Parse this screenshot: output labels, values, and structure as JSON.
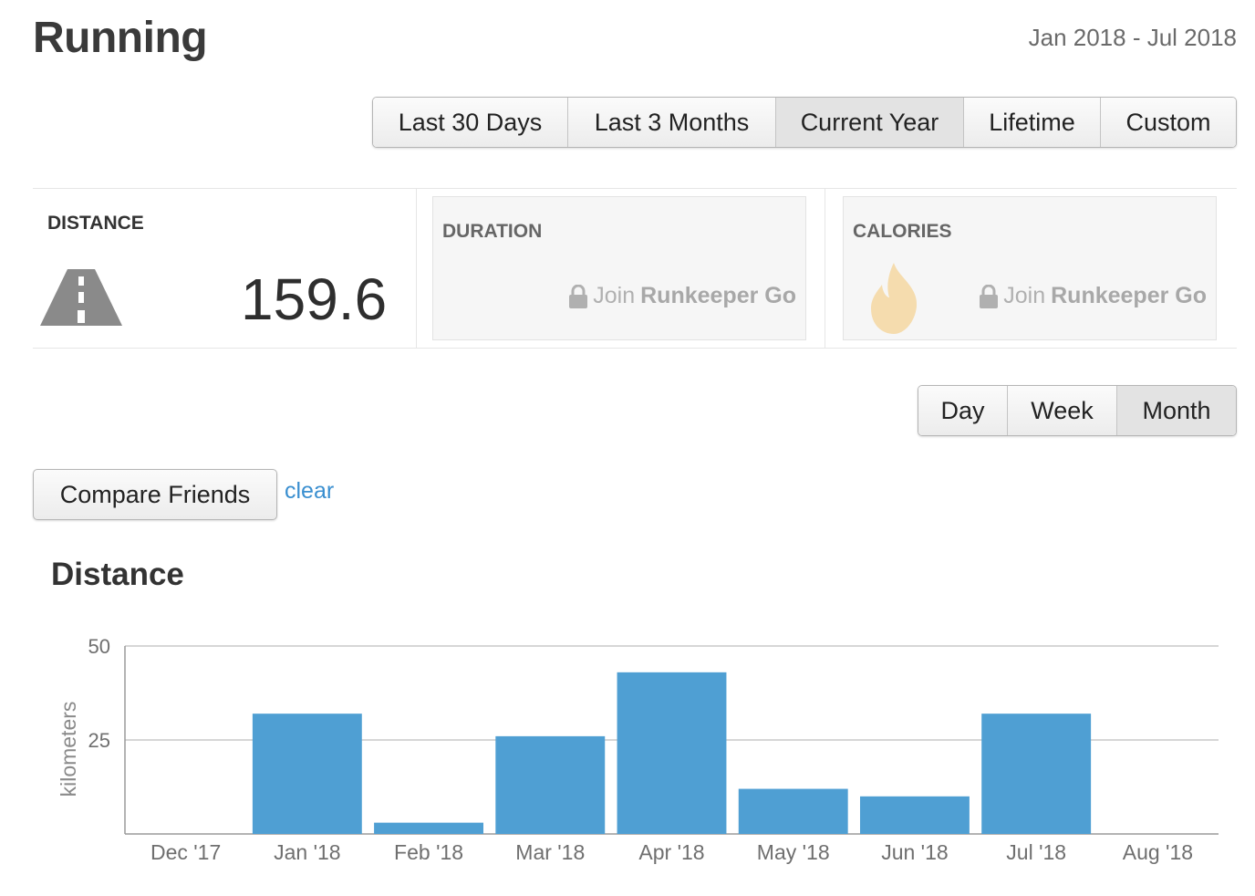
{
  "page": {
    "title": "Running",
    "date_range": "Jan 2018 - Jul 2018"
  },
  "range_buttons": [
    "Last 30 Days",
    "Last 3 Months",
    "Current Year",
    "Lifetime",
    "Custom"
  ],
  "range_active": "Current Year",
  "stats": {
    "distance": {
      "label": "DISTANCE",
      "value": "159.6",
      "icon": "road-icon"
    },
    "duration": {
      "label": "DURATION",
      "join_prefix": "Join",
      "join_brand": "Runkeeper Go",
      "icon": "lock-icon"
    },
    "calories": {
      "label": "CALORIES",
      "join_prefix": "Join",
      "join_brand": "Runkeeper Go",
      "icon": "flame-icon"
    }
  },
  "period_buttons": [
    "Day",
    "Week",
    "Month"
  ],
  "period_active": "Month",
  "compare": {
    "button_label": "Compare Friends",
    "clear_label": "clear"
  },
  "colors": {
    "bar": "#4f9fd3",
    "link": "#3a8fd0",
    "flame": "#f5dcae"
  },
  "chart_title": "Distance",
  "chart_data": {
    "type": "bar",
    "title": "Distance",
    "xlabel": "",
    "ylabel": "kilometers",
    "categories": [
      "Dec '17",
      "Jan '18",
      "Feb '18",
      "Mar '18",
      "Apr '18",
      "May '18",
      "Jun '18",
      "Jul '18",
      "Aug '18"
    ],
    "values": [
      0,
      32,
      3,
      26,
      43,
      12,
      10,
      32,
      0
    ],
    "ylim": [
      0,
      50
    ],
    "yticks": [
      25,
      50
    ],
    "grid": true,
    "legend": "none"
  }
}
